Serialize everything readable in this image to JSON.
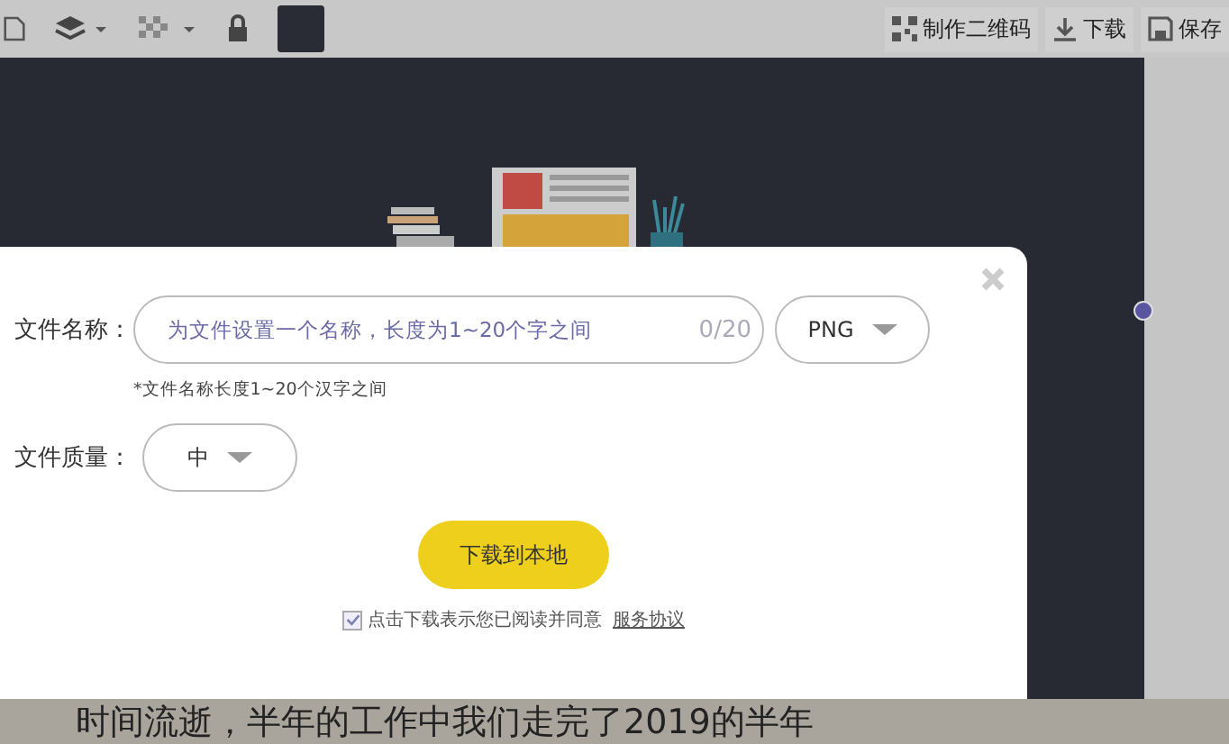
{
  "toolbar": {
    "actions": [
      {
        "kind": "qr",
        "label": "制作二维码"
      },
      {
        "kind": "download",
        "label": "下载"
      },
      {
        "kind": "save",
        "label": "保存"
      }
    ]
  },
  "dialog": {
    "name_label": "文件名称：",
    "name_field": {
      "placeholder": "为文件设置一个名称，长度为1~20个字之间",
      "counter": "0/20"
    },
    "format_select": {
      "value": "PNG"
    },
    "hint": "*文件名称长度1~20个汉字之间",
    "quality_label": "文件质量：",
    "quality_select": {
      "value": "中"
    },
    "download_button": "下载到本地",
    "agreement": {
      "checked": true,
      "text": "点击下载表示您已阅读并同意",
      "link": "服务协议"
    }
  },
  "background_text": "时间流逝，半年的工作中我们走完了2019的半年"
}
